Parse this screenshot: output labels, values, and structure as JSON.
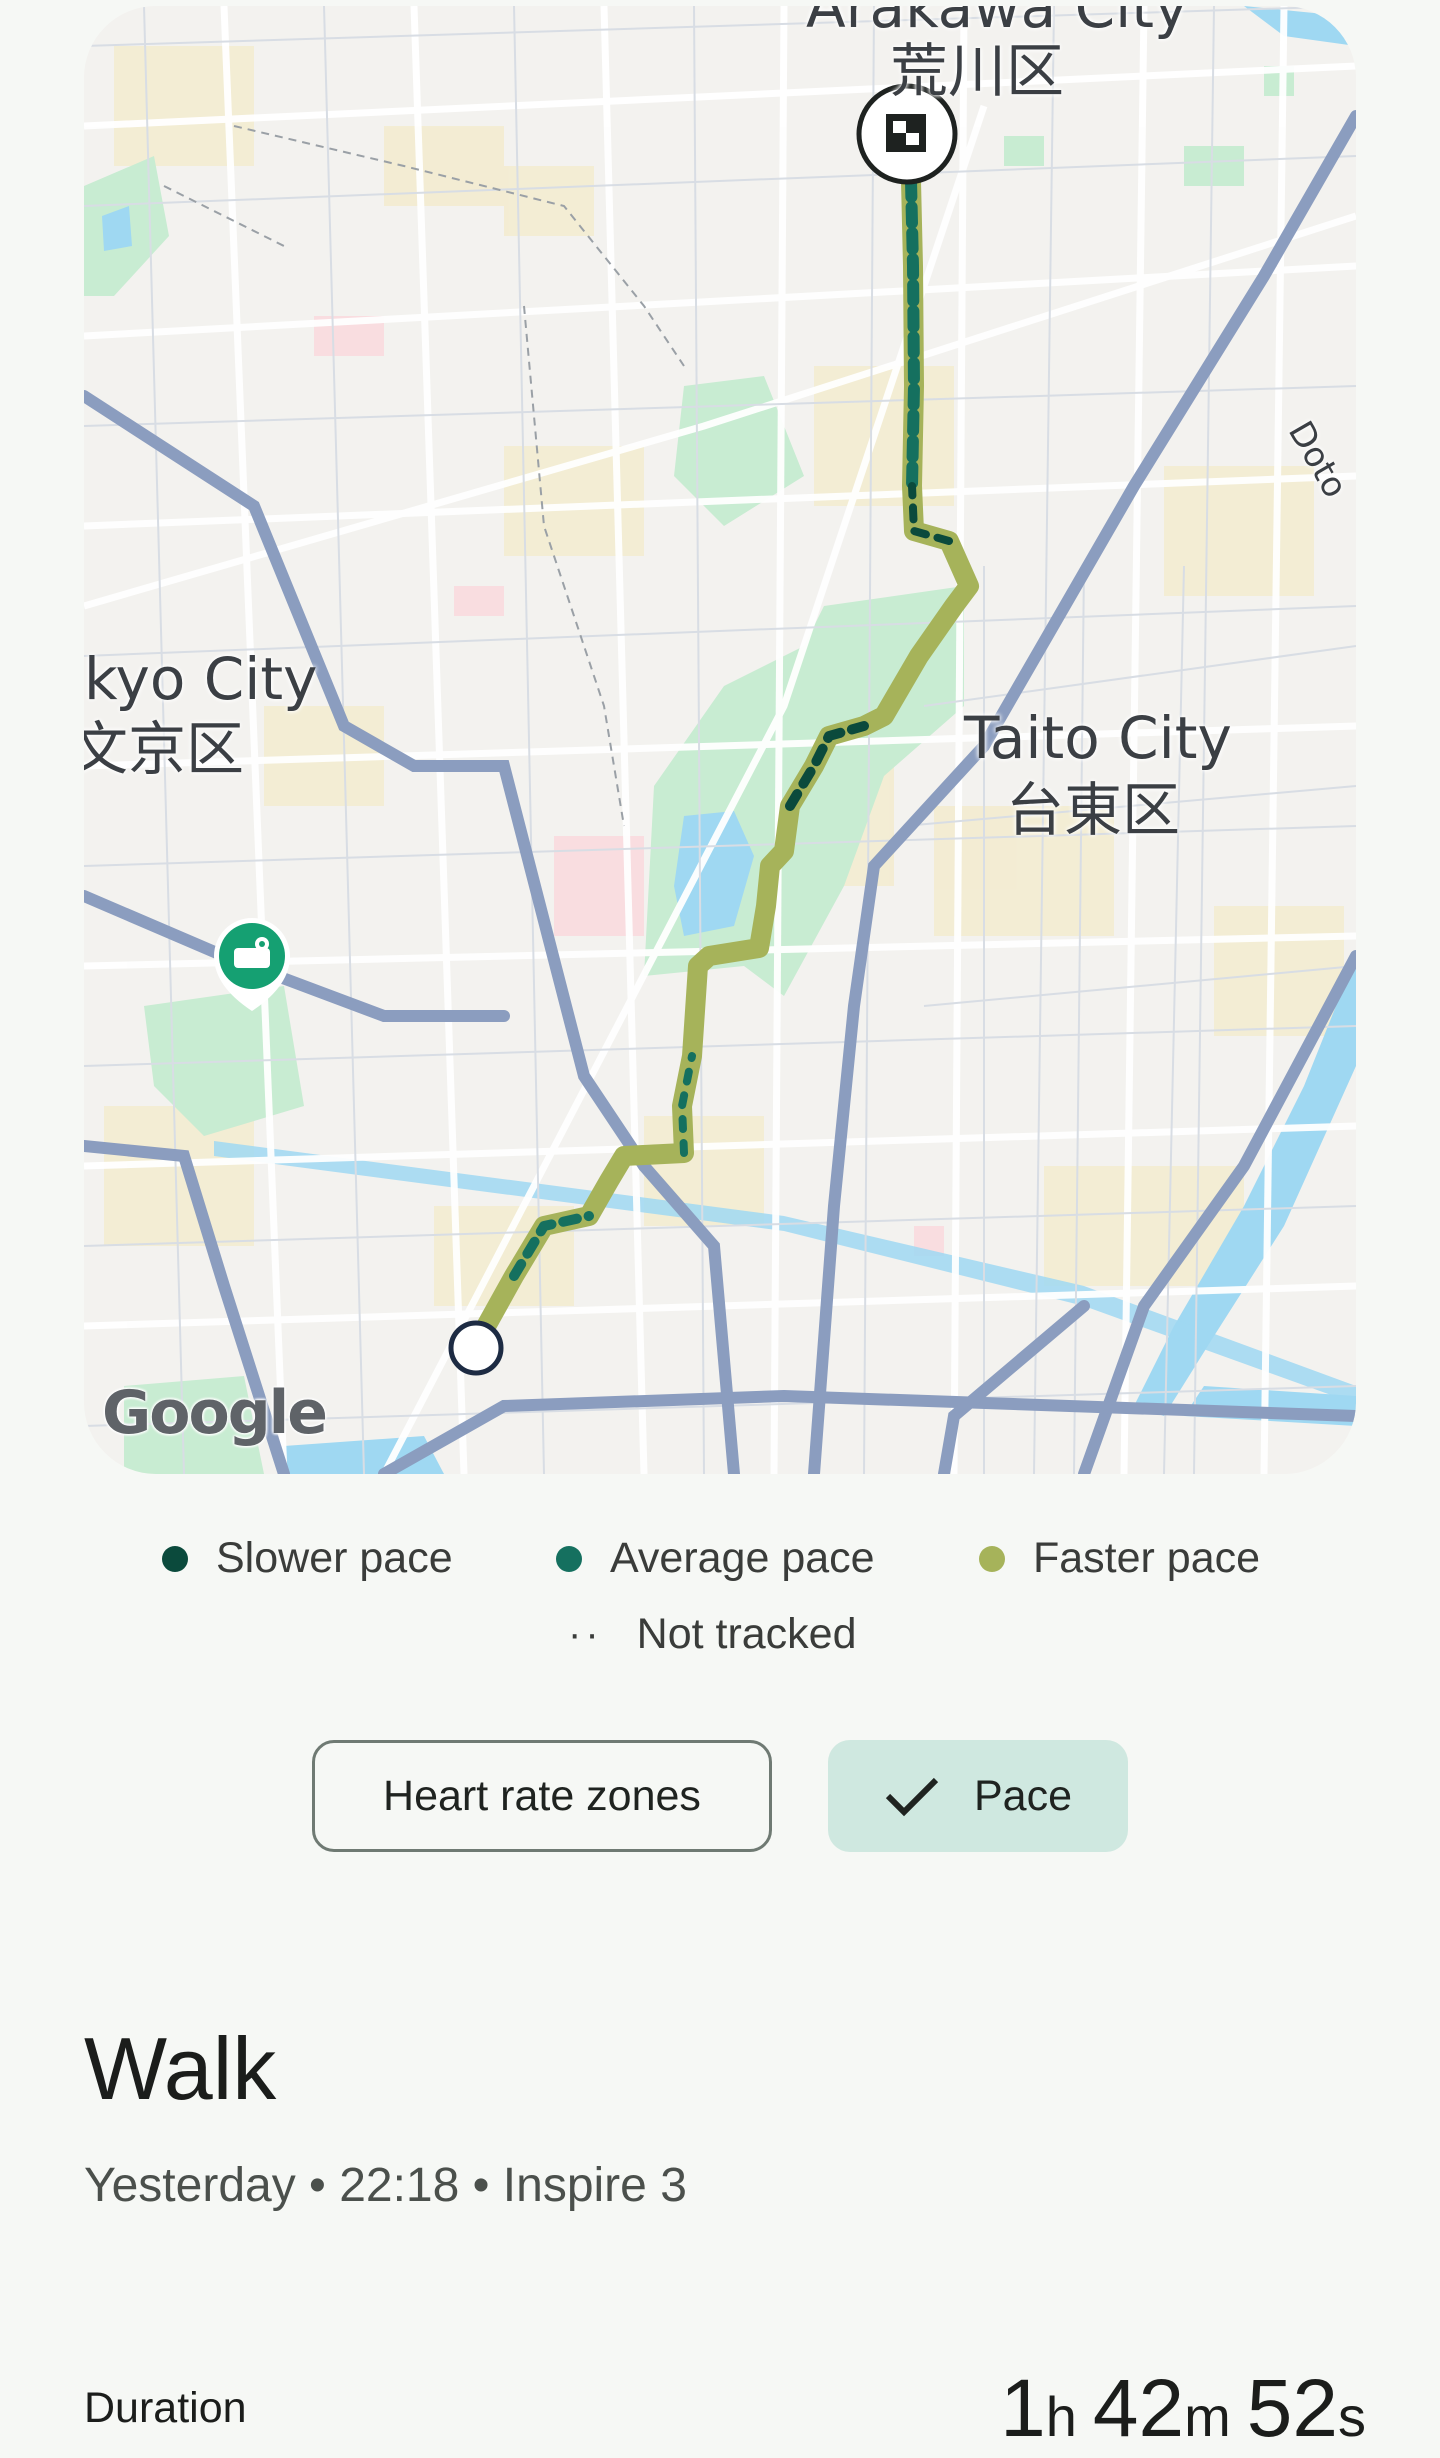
{
  "map": {
    "labels": {
      "arakawa_en": "Arakawa City",
      "arakawa_ja": "荒川区",
      "bunkyo_en": "kyo City",
      "bunkyo_ja": "文京区",
      "taito_en": "Taito City",
      "taito_ja": "台東区",
      "dotori": "Doto"
    },
    "attribution": "Google",
    "colors": {
      "slower": "#0b4a3c",
      "average": "#15705f",
      "faster": "#a6b35a",
      "park": "#c5eccf",
      "water": "#8fd3ef",
      "highway": "#8b9dbf",
      "road": "#ffffff"
    }
  },
  "legend": {
    "slower_label": "Slower pace",
    "average_label": "Average pace",
    "faster_label": "Faster pace",
    "not_tracked_label": "Not tracked"
  },
  "chips": {
    "heart_rate_label": "Heart rate zones",
    "pace_label": "Pace",
    "selected": "Pace"
  },
  "activity": {
    "title": "Walk",
    "subtitle": "Yesterday • 22:18 • Inspire 3"
  },
  "stats": {
    "duration_label": "Duration",
    "duration": {
      "hours": "1",
      "hours_unit": "h",
      "minutes": "42",
      "minutes_unit": "m",
      "seconds": "52",
      "seconds_unit": "s"
    }
  }
}
